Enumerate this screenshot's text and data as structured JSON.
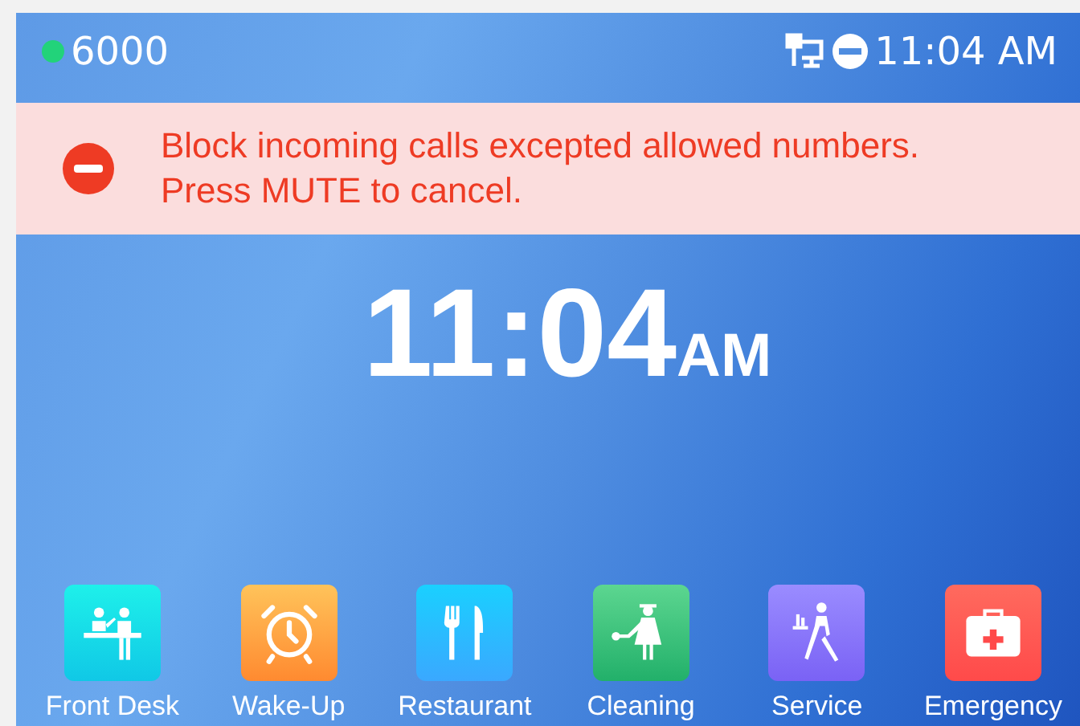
{
  "status_bar": {
    "account": "6000",
    "registered": true,
    "time": "11:04 AM"
  },
  "alert": {
    "message": "Block incoming calls excepted allowed numbers. Press MUTE to cancel."
  },
  "clock": {
    "time": "11:04",
    "suffix": "AM"
  },
  "apps": [
    {
      "kind": "front-desk",
      "label": "Front Desk"
    },
    {
      "kind": "wake-up",
      "label": "Wake-Up"
    },
    {
      "kind": "restaurant",
      "label": "Restaurant"
    },
    {
      "kind": "cleaning",
      "label": "Cleaning"
    },
    {
      "kind": "service",
      "label": "Service"
    },
    {
      "kind": "emergency",
      "label": "Emergency"
    }
  ]
}
